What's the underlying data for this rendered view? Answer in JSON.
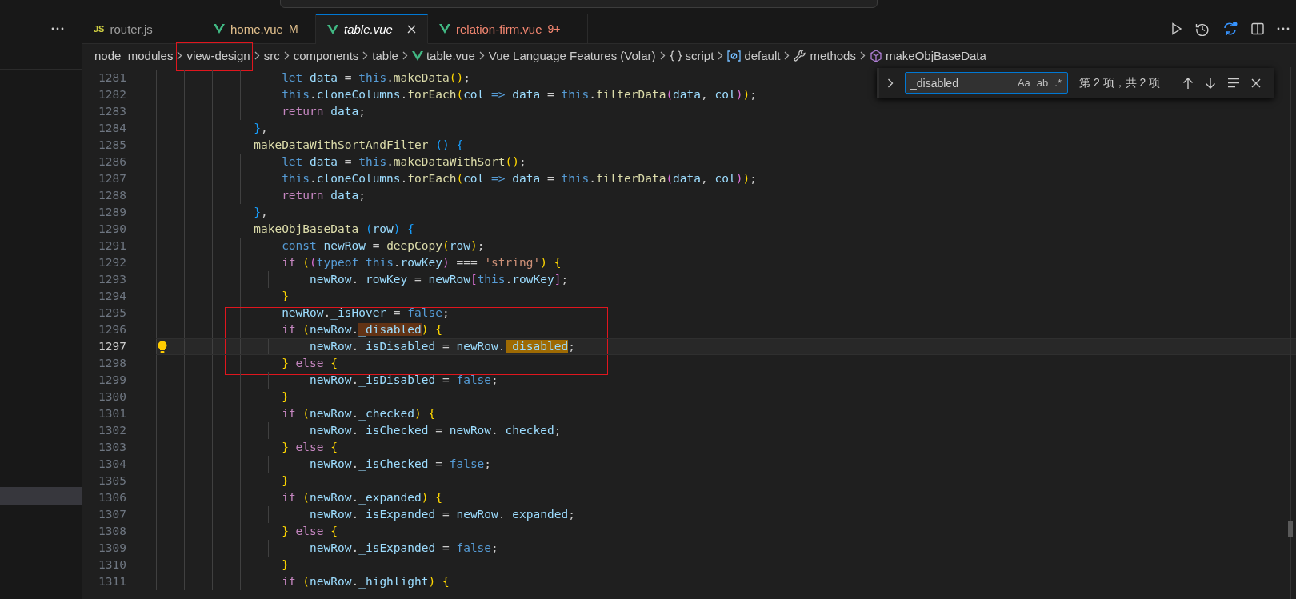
{
  "tabs": [
    {
      "label": "router.js",
      "kind": "js",
      "icon_text": "JS",
      "selected": false,
      "preview": false
    },
    {
      "label": "home.vue",
      "kind": "vue",
      "selected": false,
      "preview": false,
      "decoration": {
        "text": "M",
        "color": "#e2c08d"
      }
    },
    {
      "label": "table.vue",
      "kind": "vue",
      "selected": true,
      "preview": true
    },
    {
      "label": "relation-firm.vue",
      "kind": "vue",
      "selected": false,
      "preview": false,
      "decoration": {
        "text": "9+",
        "color": "#f48771"
      }
    }
  ],
  "breadcrumbs": [
    {
      "label": "node_modules",
      "kind": "text",
      "outlined": false
    },
    {
      "label": "view-design",
      "kind": "text",
      "outlined": true
    },
    {
      "label": "src",
      "kind": "text",
      "outlined": false
    },
    {
      "label": "components",
      "kind": "text",
      "outlined": false
    },
    {
      "label": "table",
      "kind": "text",
      "outlined": false
    },
    {
      "label": "table.vue",
      "kind": "vue",
      "outlined": false
    },
    {
      "label": "Vue Language Features (Volar)",
      "kind": "text",
      "outlined": false
    },
    {
      "label": "script",
      "kind": "braces",
      "outlined": false
    },
    {
      "label": "default",
      "kind": "module",
      "outlined": false
    },
    {
      "label": "methods",
      "kind": "wrench",
      "outlined": false
    },
    {
      "label": "makeObjBaseData",
      "kind": "cube",
      "outlined": false
    }
  ],
  "find_widget": {
    "value": "_disabled",
    "options": [
      {
        "label": "Aa",
        "on": false
      },
      {
        "label": "ab",
        "on": false
      },
      {
        "label": ".*",
        "on": false
      }
    ],
    "result": "第 2 项，共 2 项"
  },
  "code_lines": [
    {
      "n": "1281",
      "text": "                let data = this.makeData();",
      "current": false,
      "outlined": false
    },
    {
      "n": "1282",
      "text": "                this.cloneColumns.forEach(col => data = this.filterData(data, col));",
      "current": false,
      "outlined": false
    },
    {
      "n": "1283",
      "text": "                return data;",
      "current": false,
      "outlined": false
    },
    {
      "n": "1284",
      "text": "            },",
      "current": false,
      "outlined": false
    },
    {
      "n": "1285",
      "text": "            makeDataWithSortAndFilter () {",
      "current": false,
      "outlined": false
    },
    {
      "n": "1286",
      "text": "                let data = this.makeDataWithSort();",
      "current": false,
      "outlined": false
    },
    {
      "n": "1287",
      "text": "                this.cloneColumns.forEach(col => data = this.filterData(data, col));",
      "current": false,
      "outlined": false
    },
    {
      "n": "1288",
      "text": "                return data;",
      "current": false,
      "outlined": false
    },
    {
      "n": "1289",
      "text": "            },",
      "current": false,
      "outlined": false
    },
    {
      "n": "1290",
      "text": "            makeObjBaseData (row) {",
      "current": false,
      "outlined": false
    },
    {
      "n": "1291",
      "text": "                const newRow = deepCopy(row);",
      "current": false,
      "outlined": false
    },
    {
      "n": "1292",
      "text": "                if ((typeof this.rowKey) === 'string') {",
      "current": false,
      "outlined": false
    },
    {
      "n": "1293",
      "text": "                    newRow._rowKey = newRow[this.rowKey];",
      "current": false,
      "outlined": false
    },
    {
      "n": "1294",
      "text": "                }",
      "current": false,
      "outlined": false
    },
    {
      "n": "1295",
      "text": "                newRow._isHover = false;",
      "current": false,
      "outlined": true
    },
    {
      "n": "1296",
      "text": "                if (newRow.",
      "match": "_disabled",
      "rest": ") {",
      "current": false,
      "outlined": true
    },
    {
      "n": "1297",
      "text": "                    newRow._isDisabled = newRow.",
      "match": "_disabled",
      "rest": ";",
      "current": true,
      "outlined": true
    },
    {
      "n": "1298",
      "text": "                } else {",
      "current": false,
      "outlined": true
    },
    {
      "n": "1299",
      "text": "                    newRow._isDisabled = false;",
      "current": false,
      "outlined": false
    },
    {
      "n": "1300",
      "text": "                }",
      "current": false,
      "outlined": false
    },
    {
      "n": "1301",
      "text": "                if (newRow._checked) {",
      "current": false,
      "outlined": false
    },
    {
      "n": "1302",
      "text": "                    newRow._isChecked = newRow._checked;",
      "current": false,
      "outlined": false
    },
    {
      "n": "1303",
      "text": "                } else {",
      "current": false,
      "outlined": false
    },
    {
      "n": "1304",
      "text": "                    newRow._isChecked = false;",
      "current": false,
      "outlined": false
    },
    {
      "n": "1305",
      "text": "                }",
      "current": false,
      "outlined": false
    },
    {
      "n": "1306",
      "text": "                if (newRow._expanded) {",
      "current": false,
      "outlined": false
    },
    {
      "n": "1307",
      "text": "                    newRow._isExpanded = newRow._expanded;",
      "current": false,
      "outlined": false
    },
    {
      "n": "1308",
      "text": "                } else {",
      "current": false,
      "outlined": false
    },
    {
      "n": "1309",
      "text": "                    newRow._isExpanded = false;",
      "current": false,
      "outlined": false
    },
    {
      "n": "1310",
      "text": "                }",
      "current": false,
      "outlined": false
    },
    {
      "n": "1311",
      "text": "                if (newRow._highlight) {",
      "current": false,
      "outlined": false
    }
  ]
}
